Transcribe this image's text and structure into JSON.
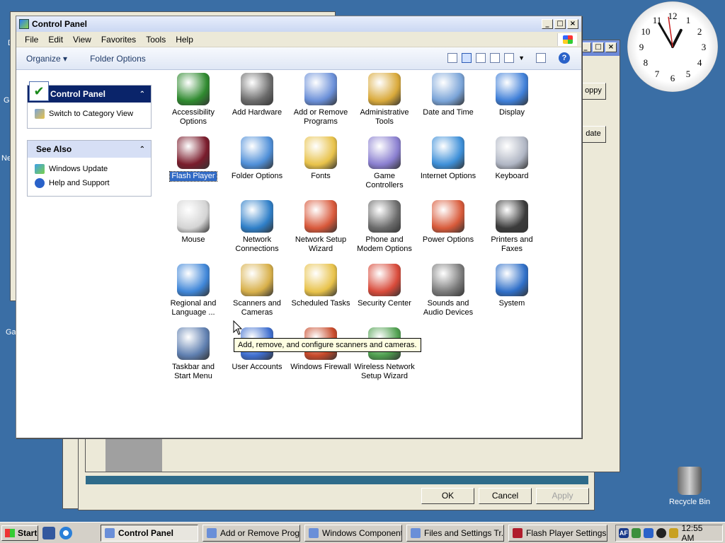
{
  "window": {
    "title": "Control Panel",
    "menu": [
      "File",
      "Edit",
      "View",
      "Favorites",
      "Tools",
      "Help"
    ],
    "toolbar": {
      "organize": "Organize ▾",
      "folder_options": "Folder Options"
    }
  },
  "left_pane": {
    "control_panel": {
      "title": "Control Panel",
      "switch_link": "Switch to Category View"
    },
    "see_also": {
      "title": "See Also",
      "links": [
        "Windows Update",
        "Help and Support"
      ]
    }
  },
  "items": [
    {
      "label": "Accessibility Options",
      "icon": "accessibility-icon",
      "color": "#2f8a2f"
    },
    {
      "label": "Add Hardware",
      "icon": "add-hardware-icon",
      "color": "#6b6b6b"
    },
    {
      "label": "Add or Remove Programs",
      "icon": "add-remove-programs-icon",
      "color": "#6a8fd8"
    },
    {
      "label": "Administrative Tools",
      "icon": "administrative-tools-icon",
      "color": "#d9a93a"
    },
    {
      "label": "Date and Time",
      "icon": "date-time-icon",
      "color": "#7aa4d8"
    },
    {
      "label": "Display",
      "icon": "display-icon",
      "color": "#3f7fd8"
    },
    {
      "label": "Flash Player",
      "icon": "flash-player-icon",
      "color": "#7a1c2c"
    },
    {
      "label": "Folder Options",
      "icon": "folder-options-icon",
      "color": "#4f8fd8"
    },
    {
      "label": "Fonts",
      "icon": "fonts-icon",
      "color": "#e8c24a"
    },
    {
      "label": "Game Controllers",
      "icon": "game-controllers-icon",
      "color": "#8a7fd0"
    },
    {
      "label": "Internet Options",
      "icon": "internet-options-icon",
      "color": "#3d8fd8"
    },
    {
      "label": "Keyboard",
      "icon": "keyboard-icon",
      "color": "#b0b6c4"
    },
    {
      "label": "Mouse",
      "icon": "mouse-icon",
      "color": "#d4d4d4"
    },
    {
      "label": "Network Connections",
      "icon": "network-connections-icon",
      "color": "#2f7fc8"
    },
    {
      "label": "Network Setup Wizard",
      "icon": "network-setup-wizard-icon",
      "color": "#d8583a"
    },
    {
      "label": "Phone and Modem Options",
      "icon": "phone-modem-icon",
      "color": "#6b6b6b"
    },
    {
      "label": "Power Options",
      "icon": "power-options-icon",
      "color": "#d85a3a"
    },
    {
      "label": "Printers and Faxes",
      "icon": "printers-faxes-icon",
      "color": "#3b3b3b"
    },
    {
      "label": "Regional and Language ...",
      "icon": "regional-language-icon",
      "color": "#3f86d8"
    },
    {
      "label": "Scanners and Cameras",
      "icon": "scanners-cameras-icon",
      "color": "#d8b04a"
    },
    {
      "label": "Scheduled Tasks",
      "icon": "scheduled-tasks-icon",
      "color": "#e8c24a"
    },
    {
      "label": "Security Center",
      "icon": "security-center-icon",
      "color": "#d84a3a"
    },
    {
      "label": "Sounds and Audio Devices",
      "icon": "sounds-audio-icon",
      "color": "#7a7a7a"
    },
    {
      "label": "System",
      "icon": "system-icon",
      "color": "#2f6fc8"
    },
    {
      "label": "Taskbar and Start Menu",
      "icon": "taskbar-start-menu-icon",
      "color": "#5f7fb0"
    },
    {
      "label": "User Accounts",
      "icon": "user-accounts-icon",
      "color": "#3f6fd0"
    },
    {
      "label": "Windows Firewall",
      "icon": "windows-firewall-icon",
      "color": "#c84a2a"
    },
    {
      "label": "Wireless Network Setup Wizard",
      "icon": "wireless-network-icon",
      "color": "#4fa04f"
    }
  ],
  "tooltip": "Add, remove, and configure scanners and cameras.",
  "background_dialog": {
    "ok": "OK",
    "cancel": "Cancel",
    "apply": "Apply",
    "btn1": "oppy",
    "btn2": "date"
  },
  "desktop": {
    "recycle_bin": "Recycle Bin",
    "frag1": "D",
    "frag2": "Ga",
    "frag3": "Ne",
    "frag4": "Ga"
  },
  "clock_numbers": [
    "12",
    "1",
    "2",
    "3",
    "4",
    "5",
    "6",
    "7",
    "8",
    "9",
    "10",
    "11"
  ],
  "taskbar": {
    "start": "Start",
    "tasks": [
      {
        "label": "Control Panel",
        "active": true
      },
      {
        "label": "Add or Remove Prog..."
      },
      {
        "label": "Windows Component..."
      },
      {
        "label": "Files and Settings Tr..."
      },
      {
        "label": "Flash Player Settings..."
      }
    ],
    "tray_lang": "AF",
    "time": "12:55 AM"
  }
}
